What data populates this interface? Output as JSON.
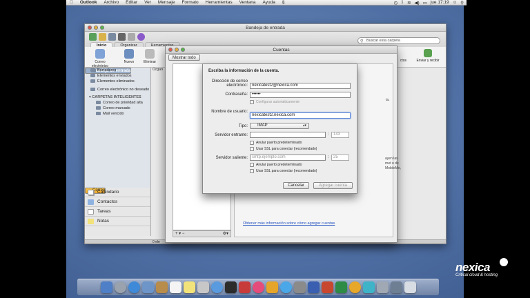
{
  "menubar": {
    "app": "Outlook",
    "items": [
      "Archivo",
      "Editar",
      "Ver",
      "Mensaje",
      "Formato",
      "Herramientas",
      "Ventana",
      "Ayuda"
    ],
    "clock": "jue 17:19"
  },
  "outlook": {
    "title": "Bandeja de entrada",
    "search_placeholder": "Buscar esta carpeta",
    "tabs": [
      "Inicio",
      "Organizar",
      "Herramientas"
    ],
    "ribbon": [
      "Correo electrónico",
      "Nuevo",
      "Eliminar"
    ],
    "right_button": "Enviar y recibir",
    "right_button_partial": "ctos",
    "msglist_header": "Organ",
    "folders": [
      {
        "label": "Bandeja de entrada",
        "selected": true
      },
      {
        "label": "Borradores"
      },
      {
        "label": "Elementos enviados"
      },
      {
        "label": "Elementos eliminados"
      },
      {
        "label": "Correo electrónico no deseado"
      }
    ],
    "smart_header": "CARPETAS INTELIGENTES",
    "smart_folders": [
      "Correo de prioridad alta",
      "Correo marcado",
      "Mail vencido"
    ],
    "nav": [
      "Correo",
      "Calendario",
      "Contactos",
      "Tareas",
      "Notas"
    ],
    "status": "0 ele"
  },
  "cuentas": {
    "title": "Cuentas",
    "show_all": "Mostrar todo",
    "side_text_1": "ta.",
    "side_text_2": [
      "ayen las",
      "rnet o de",
      "MobileMe,"
    ],
    "more_info": "Obtener más información sobre cómo agregar cuentas",
    "tools": "+ ▾  −"
  },
  "sheet": {
    "title": "Escriba la información de la cuenta.",
    "email_label": "Dirección de correo electrónico:",
    "email_value": "nexicatest2@nexica.com",
    "password_label": "Contraseña:",
    "password_value": "••••••",
    "auto_config": "Configurar automáticamente",
    "username_label": "Nombre de usuario:",
    "username_value": "nexicatest2.nexica.com",
    "type_label": "Tipo:",
    "type_value": "IMAP",
    "incoming_label": "Servidor entrante:",
    "incoming_port": "143",
    "override_port_1": "Anular puerto predeterminado",
    "ssl_1": "Usar SSL para conectar (recomendado)",
    "outgoing_label": "Servidor saliente:",
    "outgoing_placeholder": "smtp.ejemplo.com",
    "outgoing_port": "25",
    "override_port_2": "Anular puerto predeterminado",
    "ssl_2": "Usar SSL para conectar (recomendado)",
    "cancel": "Cancelar",
    "add": "Agregar cuenta"
  },
  "logo": {
    "word": "nexica",
    "tagline": "Critical cloud & hosting"
  },
  "colors": {
    "desktop": "#5576a8",
    "accent": "#eda52a",
    "link": "#2b59c3"
  }
}
